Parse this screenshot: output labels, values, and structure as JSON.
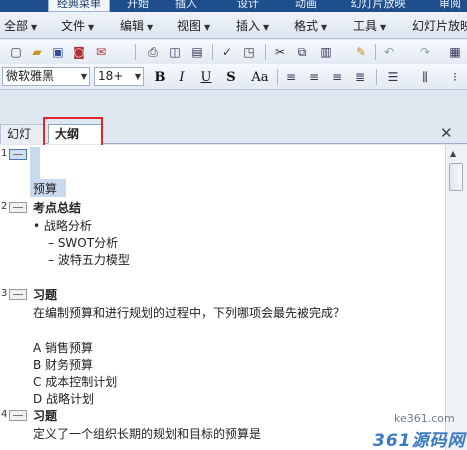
{
  "ribbon_tabs": [
    "经典菜单",
    "开始",
    "插入",
    "设计",
    "动画",
    "幻灯片放映",
    "审阅"
  ],
  "menubar": [
    "全部",
    "文件",
    "编辑",
    "视图",
    "插入",
    "格式",
    "工具",
    "幻灯片放映"
  ],
  "font": {
    "name": "微软雅黑",
    "size": "18+"
  },
  "format_buttons": [
    "B",
    "I",
    "U",
    "S",
    "Aa"
  ],
  "panel_tabs": {
    "slides": "幻灯片",
    "outline": "大纲"
  },
  "outline": {
    "s1": {
      "num": "1",
      "text": "预算"
    },
    "s2": {
      "num": "2",
      "title": "考点总结",
      "bullet": "• 战略分析",
      "sub1": "– SWOT分析",
      "sub2": "– 波特五力模型"
    },
    "s3": {
      "num": "3",
      "title": "习题",
      "question": "在编制预算和进行规划的过程中，下列哪项会最先被完成？",
      "a": "A   销售预算",
      "b": "B   财务预算",
      "c": "C   成本控制计划",
      "d": "D   战略计划"
    },
    "s4": {
      "num": "4",
      "title": "习题",
      "question": "定义了一个组织长期的规划和目标的预算是"
    }
  },
  "watermark": {
    "url": "ke361.com",
    "logo": "361源码网"
  }
}
